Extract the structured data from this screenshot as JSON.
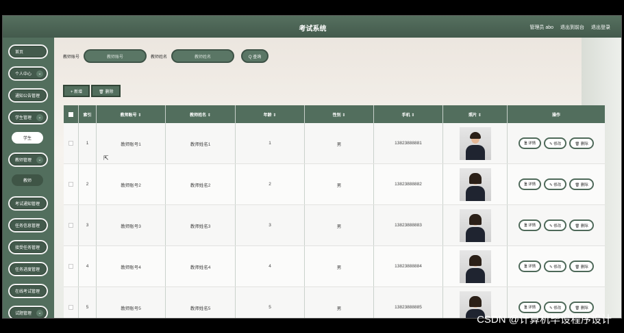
{
  "header": {
    "title": "考试系统",
    "links": [
      "管理员 abo",
      "退出到前台",
      "退出登录"
    ]
  },
  "sidebar": {
    "items": [
      {
        "label": "首页",
        "top": 0
      },
      {
        "label": "个人中心",
        "chev": "⌄"
      },
      {
        "label": "通知公告管理"
      },
      {
        "label": "学生管理",
        "chev": "⌄"
      },
      {
        "label": "学生",
        "sub": "light"
      },
      {
        "label": "教师管理",
        "chev": "⌄"
      },
      {
        "label": "教师",
        "sub": "dark"
      },
      {
        "label": "考试通知管理"
      },
      {
        "label": "任务信息管理"
      },
      {
        "label": "接受任务管理"
      },
      {
        "label": "任务进度管理"
      },
      {
        "label": "在线考试管理"
      },
      {
        "label": "试题管理",
        "chev": "⌄"
      }
    ]
  },
  "search": {
    "account_label": "教师账号",
    "account_placeholder": "教师账号",
    "name_label": "教师姓名",
    "name_placeholder": "教师姓名",
    "button_label": "Q 查询"
  },
  "toolbar": {
    "add_label": "+ 新增",
    "delete_label": "🗑 删除"
  },
  "table": {
    "headers": [
      "",
      "索引",
      "教师账号 ⇕",
      "教师姓名 ⇕",
      "年龄 ⇕",
      "性别 ⇕",
      "手机 ⇕",
      "照片 ⇕",
      "操作"
    ],
    "rows": [
      {
        "index": "1",
        "account": "教师账号1",
        "name": "教师姓名1",
        "age": "1",
        "gender": "男",
        "phone": "13823888881",
        "photo": "male"
      },
      {
        "index": "2",
        "account": "教师账号2",
        "name": "教师姓名2",
        "age": "2",
        "gender": "男",
        "phone": "13823888882",
        "photo": "female"
      },
      {
        "index": "3",
        "account": "教师账号3",
        "name": "教师姓名3",
        "age": "3",
        "gender": "男",
        "phone": "13823888883",
        "photo": "female"
      },
      {
        "index": "4",
        "account": "教师账号4",
        "name": "教师姓名4",
        "age": "4",
        "gender": "男",
        "phone": "13823888884",
        "photo": "female"
      },
      {
        "index": "5",
        "account": "教师账号5",
        "name": "教师姓名5",
        "age": "5",
        "gender": "男",
        "phone": "13823888885",
        "photo": "female"
      }
    ],
    "ops": [
      "🗎 详情",
      "✎ 修改",
      "🗑 删除"
    ]
  },
  "watermark": "CSDN @计算机毕设程序设计"
}
